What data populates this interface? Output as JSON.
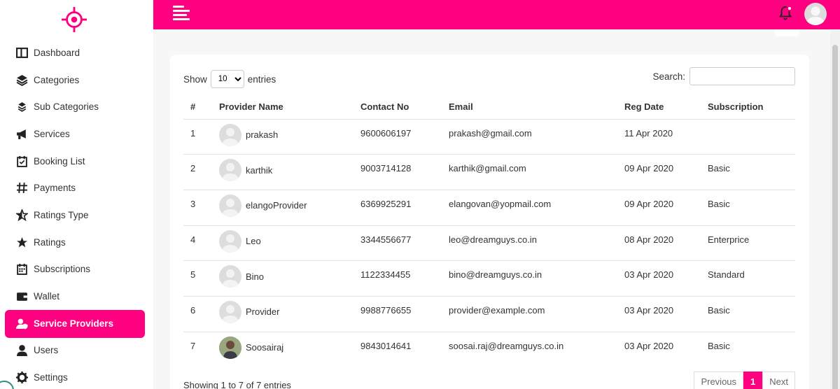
{
  "sidebar": {
    "items": [
      {
        "label": "Dashboard",
        "icon": "dashboard-icon"
      },
      {
        "label": "Categories",
        "icon": "layers-icon"
      },
      {
        "label": "Sub Categories",
        "icon": "layers-small-icon"
      },
      {
        "label": "Services",
        "icon": "megaphone-icon"
      },
      {
        "label": "Booking List",
        "icon": "calendar-check-icon"
      },
      {
        "label": "Payments",
        "icon": "hashtag-icon"
      },
      {
        "label": "Ratings Type",
        "icon": "star-half-icon"
      },
      {
        "label": "Ratings",
        "icon": "star-icon"
      },
      {
        "label": "Subscriptions",
        "icon": "calendar-icon"
      },
      {
        "label": "Wallet",
        "icon": "wallet-icon"
      },
      {
        "label": "Service Providers",
        "icon": "user-shield-icon"
      },
      {
        "label": "Users",
        "icon": "user-icon"
      },
      {
        "label": "Settings",
        "icon": "gear-icon"
      }
    ]
  },
  "colors": {
    "accent": "#ff0080"
  },
  "table_controls": {
    "show_label": "Show",
    "entries_label": "entries",
    "page_size": "10",
    "search_label": "Search:"
  },
  "table": {
    "headers": [
      "#",
      "Provider Name",
      "Contact No",
      "Email",
      "Reg Date",
      "Subscription"
    ],
    "rows": [
      {
        "num": "1",
        "name": "prakash",
        "contact": "9600606197",
        "email": "prakash@gmail.com",
        "date": "11 Apr 2020",
        "sub": ""
      },
      {
        "num": "2",
        "name": "karthik",
        "contact": "9003714128",
        "email": "karthik@gmail.com",
        "date": "09 Apr 2020",
        "sub": "Basic"
      },
      {
        "num": "3",
        "name": "elangoProvider",
        "contact": "6369925291",
        "email": "elangovan@yopmail.com",
        "date": "09 Apr 2020",
        "sub": "Basic"
      },
      {
        "num": "4",
        "name": "Leo",
        "contact": "3344556677",
        "email": "leo@dreamguys.co.in",
        "date": "08 Apr 2020",
        "sub": "Enterprice"
      },
      {
        "num": "5",
        "name": "Bino",
        "contact": "1122334455",
        "email": "bino@dreamguys.co.in",
        "date": "03 Apr 2020",
        "sub": "Standard"
      },
      {
        "num": "6",
        "name": "Provider",
        "contact": "9988776655",
        "email": "provider@example.com",
        "date": "03 Apr 2020",
        "sub": "Basic"
      },
      {
        "num": "7",
        "name": "Soosairaj",
        "contact": "9843014641",
        "email": "soosai.raj@dreamguys.co.in",
        "date": "03 Apr 2020",
        "sub": "Basic"
      }
    ]
  },
  "footer": {
    "info": "Showing 1 to 7 of 7 entries",
    "prev": "Previous",
    "page": "1",
    "next": "Next"
  }
}
